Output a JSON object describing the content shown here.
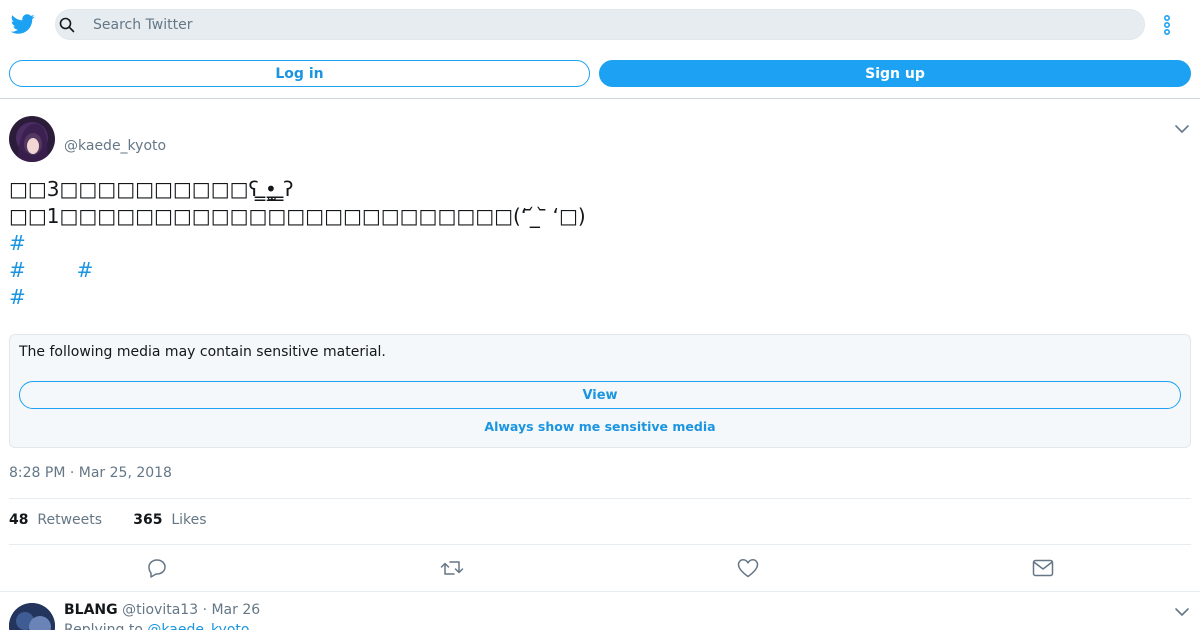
{
  "header": {
    "search_placeholder": "Search Twitter",
    "login_label": "Log in",
    "signup_label": "Sign up"
  },
  "tweet": {
    "handle": "@kaede_kyoto",
    "lines": [
      "□□3□□□□□□□□□□ʕ ̳̳̳•̫̳ ̳̳̳ʔ",
      "□□1□□□□□□□□□□□□□□□□□□□□□□□□(‘ ᷄ ̲ ᷅ ‘□)",
      "#",
      "#        #",
      "#"
    ],
    "sensitive": {
      "message": "The following media may contain sensitive material.",
      "view_label": "View",
      "always_label": "Always show me sensitive media"
    },
    "timestamp": "8:28 PM · Mar 25, 2018",
    "stats": {
      "retweets_count": "48",
      "retweets_label": "Retweets",
      "likes_count": "365",
      "likes_label": "Likes"
    }
  },
  "reply": {
    "name": "BLANG",
    "handle": "@tiovita13",
    "date": "· Mar 26",
    "replying_prefix": "Replying to",
    "replying_mention": "@kaede_kyoto"
  },
  "colors": {
    "brand": "#1da1f2",
    "link": "#1b95e0",
    "muted": "#657786"
  },
  "icons": {
    "logo": "twitter-bird-icon",
    "search": "search-icon",
    "more": "more-vertical-icon",
    "caret": "chevron-down-icon",
    "reply": "reply-icon",
    "retweet": "retweet-icon",
    "like": "heart-icon",
    "dm": "envelope-icon"
  }
}
